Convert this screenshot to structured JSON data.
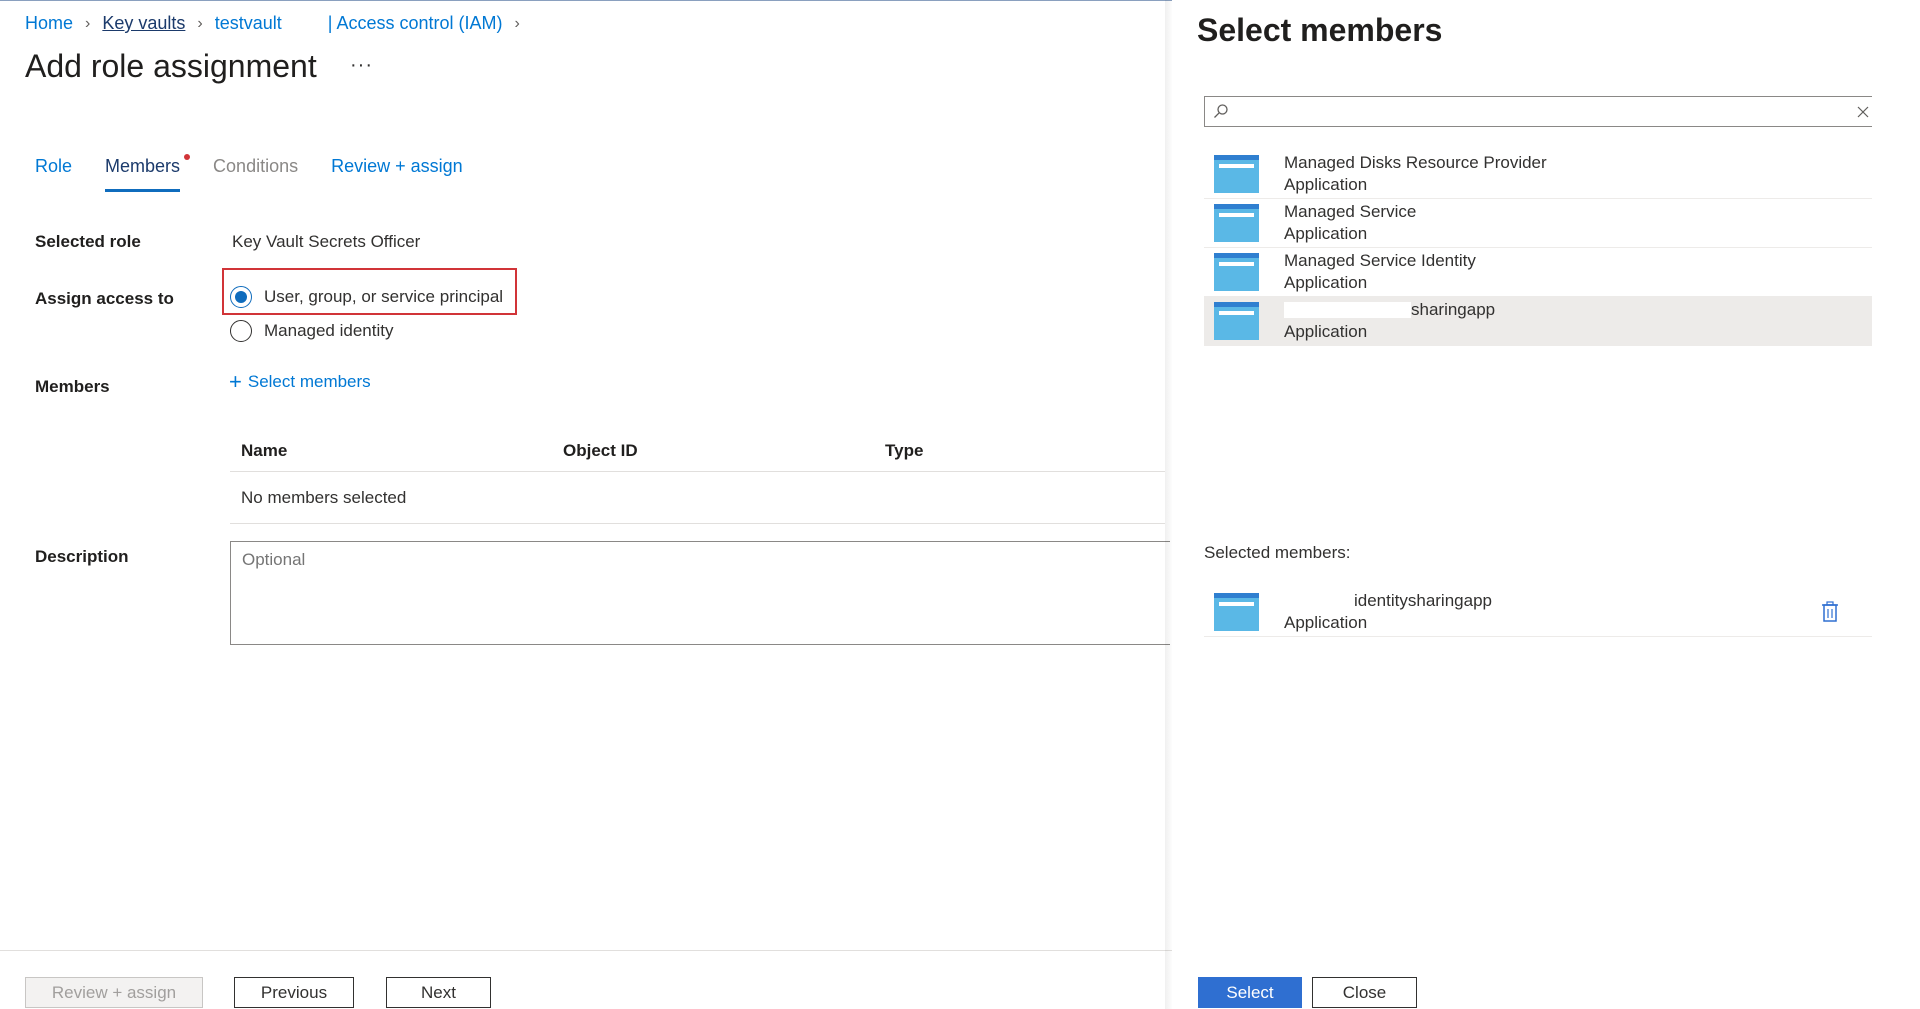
{
  "breadcrumb": {
    "home": "Home",
    "key_vaults": "Key vaults",
    "vault": "testvault",
    "iam": "| Access control (IAM)"
  },
  "page": {
    "title": "Add role assignment",
    "more": "···"
  },
  "tabs": {
    "role": "Role",
    "members": "Members",
    "conditions": "Conditions",
    "review": "Review + assign"
  },
  "form": {
    "selected_role_label": "Selected role",
    "selected_role_value": "Key Vault Secrets Officer",
    "assign_access_label": "Assign access to",
    "option_user": "User, group, or service principal",
    "option_managed": "Managed identity",
    "members_label": "Members",
    "select_members_link": "Select members",
    "table_headers": [
      "Name",
      "Object ID",
      "Type"
    ],
    "no_members": "No members selected",
    "description_label": "Description",
    "description_placeholder": "Optional"
  },
  "footer": {
    "review_assign": "Review + assign",
    "previous": "Previous",
    "next": "Next"
  },
  "panel": {
    "title": "Select members",
    "search_value": "",
    "results": [
      {
        "name": "Managed Disks Resource Provider",
        "type": "Application"
      },
      {
        "name": "Managed Service",
        "type": "Application"
      },
      {
        "name": "Managed Service Identity",
        "type": "Application"
      },
      {
        "name": "sharingapp",
        "type": "Application"
      }
    ],
    "selected_label": "Selected members:",
    "selected": [
      {
        "name": "identitysharingapp",
        "type": "Application"
      }
    ],
    "select_button": "Select",
    "close_button": "Close"
  },
  "colors": {
    "accent": "#0078d4",
    "primary_button": "#2f6fd1",
    "highlight_border": "#d13438",
    "app_icon": "#5ab8e6"
  }
}
